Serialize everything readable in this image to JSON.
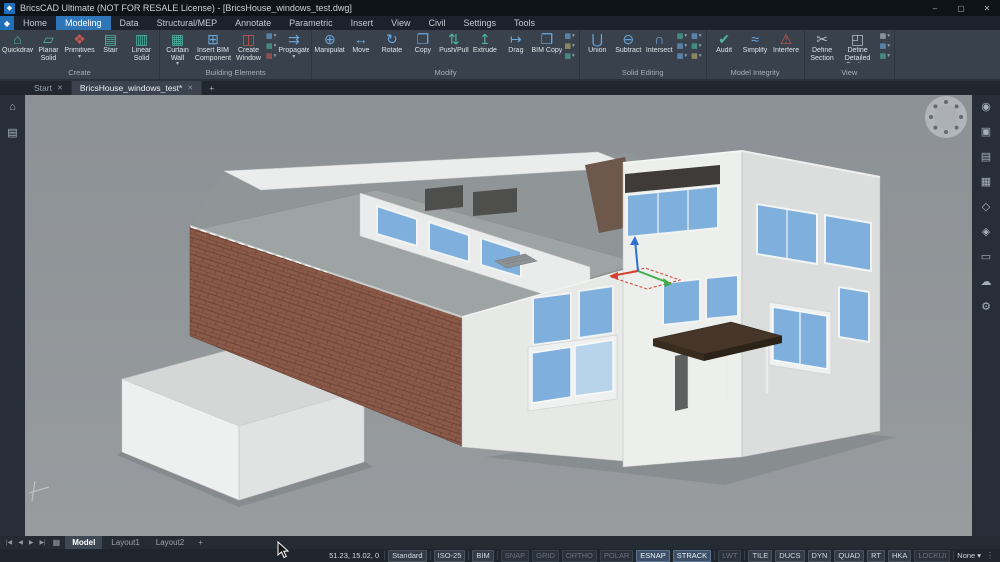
{
  "colors": {
    "accent": "#2e76b8",
    "viewport_bg": "#8f9498",
    "wall_light": "#edefed",
    "wall_shade": "#dbdedd",
    "wall_center": "#e7e9e7",
    "brick": "#8a5947",
    "glass": "#7fb0dd",
    "glass_light": "#b7d4ec",
    "roof": "#9ea3a3",
    "canopy": "#463629"
  },
  "window": {
    "logo_glyph": "◆",
    "title": "BricsCAD Ultimate (NOT FOR RESALE License) - [BricsHouse_windows_test.dwg]",
    "minimize": "–",
    "maximize": "▢",
    "close": "✕"
  },
  "menu": {
    "tabs": [
      {
        "label": "Home"
      },
      {
        "label": "Modeling",
        "active": true
      },
      {
        "label": "Data"
      },
      {
        "label": "Structural/MEP"
      },
      {
        "label": "Annotate"
      },
      {
        "label": "Parametric"
      },
      {
        "label": "Insert"
      },
      {
        "label": "View"
      },
      {
        "label": "Civil"
      },
      {
        "label": "Settings"
      },
      {
        "label": "Tools"
      }
    ]
  },
  "icons": {
    "quickdraw": "⌂",
    "planar_solid": "▱",
    "primitives": "❖",
    "stair": "▤",
    "linear_solid": "▥",
    "curtain_wall": "▦",
    "insert_bim": "⊞",
    "create_window": "◫",
    "propagate": "⇉",
    "manipulate": "⊕",
    "move": "↔",
    "rotate": "↻",
    "copy": "❐",
    "push_pull": "⇅",
    "extrude": "↥",
    "drag": "↦",
    "bim_copy": "❒",
    "union": "⋃",
    "subtract": "⊖",
    "intersect": "∩",
    "audit": "✔",
    "simplify": "≈",
    "interfere": "⚠",
    "define_section": "✂",
    "define_detail": "◰",
    "mini": "▦",
    "dropdown": "▾"
  },
  "ribbon": {
    "groups": [
      {
        "name": "Create",
        "buttons": [
          {
            "label": "Quickdraw"
          },
          {
            "label": "Planar Solid"
          },
          {
            "label": "Primitives",
            "dropdown": true
          },
          {
            "label": "Stair"
          },
          {
            "label": "Linear Solid"
          }
        ]
      },
      {
        "name": "Building Elements",
        "buttons": [
          {
            "label": "Curtain Wall",
            "dropdown": true
          },
          {
            "label": "Insert BIM Component"
          },
          {
            "label": "Create Window"
          },
          {
            "label": "Propagate",
            "dropdown": true
          }
        ]
      },
      {
        "name": "Modify",
        "buttons": [
          {
            "label": "Manipulate"
          },
          {
            "label": "Move"
          },
          {
            "label": "Rotate"
          },
          {
            "label": "Copy"
          },
          {
            "label": "Push/Pull"
          },
          {
            "label": "Extrude"
          },
          {
            "label": "Drag"
          },
          {
            "label": "BIM Copy"
          }
        ]
      },
      {
        "name": "Solid Editing",
        "buttons": [
          {
            "label": "Union"
          },
          {
            "label": "Subtract"
          },
          {
            "label": "Intersect"
          }
        ]
      },
      {
        "name": "Model Integrity",
        "buttons": [
          {
            "label": "Audit"
          },
          {
            "label": "Simplify"
          },
          {
            "label": "Interfere"
          }
        ]
      },
      {
        "name": "View",
        "buttons": [
          {
            "label": "Define Section"
          },
          {
            "label": "Define Detailed Section"
          }
        ]
      }
    ]
  },
  "doc_tabs": {
    "close": "✕",
    "add": "+",
    "tabs": [
      {
        "label": "Start"
      },
      {
        "label": "BricsHouse_windows_test*",
        "active": true
      }
    ]
  },
  "left_sidebar": {
    "items": [
      {
        "name": "home",
        "glyph": "⌂"
      },
      {
        "name": "panels",
        "glyph": "▤"
      }
    ]
  },
  "right_sidebar": {
    "items": [
      {
        "name": "tips",
        "glyph": "◉"
      },
      {
        "name": "properties",
        "glyph": "▣"
      },
      {
        "name": "layers",
        "glyph": "▤"
      },
      {
        "name": "sheets",
        "glyph": "▦"
      },
      {
        "name": "components",
        "glyph": "◇"
      },
      {
        "name": "materials",
        "glyph": "◈"
      },
      {
        "name": "render",
        "glyph": "▭"
      },
      {
        "name": "cloud",
        "glyph": "☁"
      },
      {
        "name": "settings",
        "glyph": "⚙"
      }
    ]
  },
  "layout_bar": {
    "nav": [
      "|◀",
      "◀",
      "▶",
      "▶|"
    ],
    "grid_glyph": "▦",
    "tabs": [
      {
        "label": "Model",
        "active": true
      },
      {
        "label": "Layout1"
      },
      {
        "label": "Layout2"
      }
    ],
    "add": "+"
  },
  "status": {
    "coords": "51.23, 15.02, 0",
    "dropdown": "▾",
    "overflow": "⋮",
    "items": [
      {
        "label": "Standard",
        "state": "normal"
      },
      {
        "label": "ISO-25",
        "state": "normal"
      },
      {
        "label": "BIM",
        "state": "normal"
      },
      {
        "label": "SNAP",
        "state": "off"
      },
      {
        "label": "GRID",
        "state": "off"
      },
      {
        "label": "ORTHO",
        "state": "off"
      },
      {
        "label": "POLAR",
        "state": "off"
      },
      {
        "label": "ESNAP",
        "state": "on"
      },
      {
        "label": "STRACK",
        "state": "on"
      },
      {
        "label": "LWT",
        "state": "off"
      },
      {
        "label": "TILE",
        "state": "normal"
      },
      {
        "label": "DUCS",
        "state": "normal"
      },
      {
        "label": "DYN",
        "state": "normal"
      },
      {
        "label": "QUAD",
        "state": "normal"
      },
      {
        "label": "RT",
        "state": "normal"
      },
      {
        "label": "HKA",
        "state": "normal"
      },
      {
        "label": "LOCKUI",
        "state": "off"
      },
      {
        "label": "None",
        "state": "normal"
      }
    ]
  }
}
